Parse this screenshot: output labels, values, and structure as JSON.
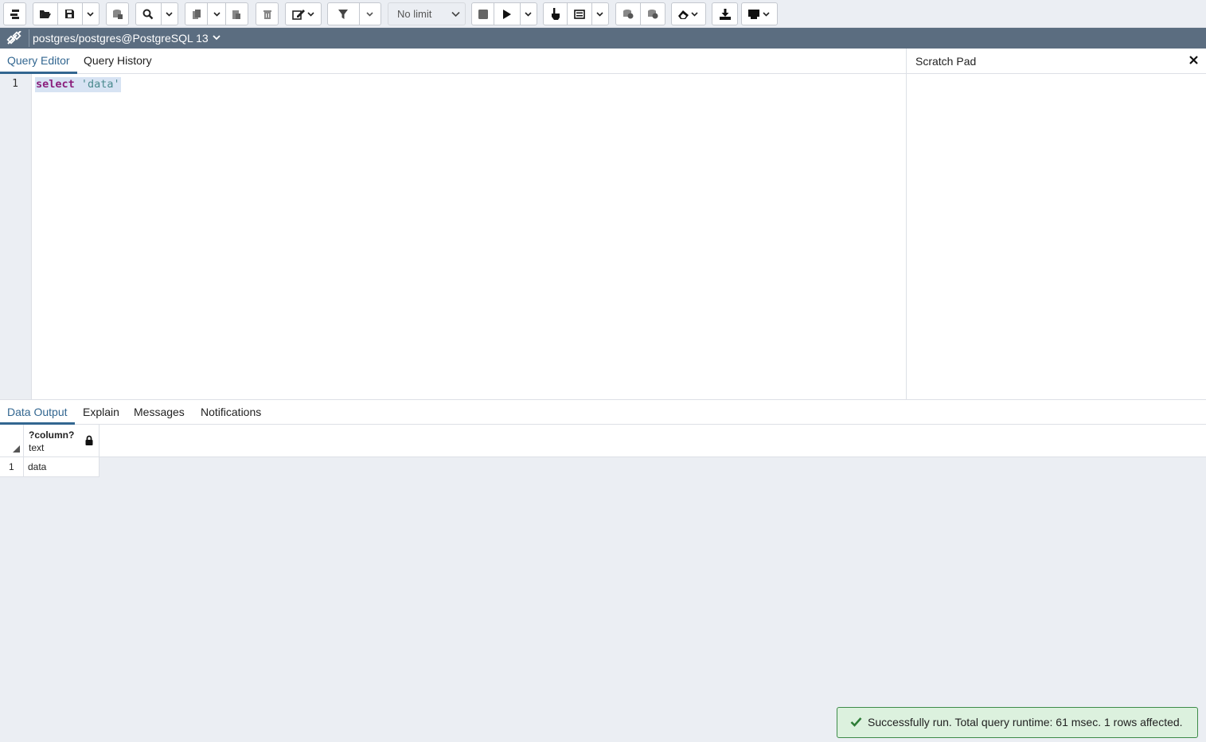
{
  "toolbar": {
    "row_limit": "No limit",
    "buttons": [
      "browser-icon",
      "open-file-icon",
      "save-icon",
      "save-data-icon",
      "find-icon",
      "copy-icon",
      "paste-icon",
      "delete-icon",
      "edit-icon",
      "filter-icon",
      "stop-icon",
      "execute-icon",
      "explain-icon",
      "explain-analyze-icon",
      "commit-icon",
      "rollback-icon",
      "clear-icon",
      "download-icon",
      "macros-icon"
    ]
  },
  "connection": {
    "label": "postgres/postgres@PostgreSQL 13"
  },
  "editor": {
    "tabs": [
      "Query Editor",
      "Query History"
    ],
    "line_number": "1",
    "code_keyword": "select",
    "code_string": "'data'"
  },
  "scratch_pad": {
    "title": "Scratch Pad"
  },
  "output": {
    "tabs": [
      "Data Output",
      "Explain",
      "Messages",
      "Notifications"
    ],
    "columns": [
      {
        "name": "?column?",
        "type": "text"
      }
    ],
    "rows": [
      {
        "row_number": "1",
        "values": [
          "data"
        ]
      }
    ]
  },
  "toast": {
    "message": "Successfully run. Total query runtime: 61 msec. 1 rows affected."
  },
  "colors": {
    "accent": "#326690",
    "connection_bar": "#5b6d80",
    "success_border": "#3d8b48",
    "success_bg": "#dcf1de",
    "keyword": "#8a1e7c",
    "string": "#4a8a8e"
  }
}
